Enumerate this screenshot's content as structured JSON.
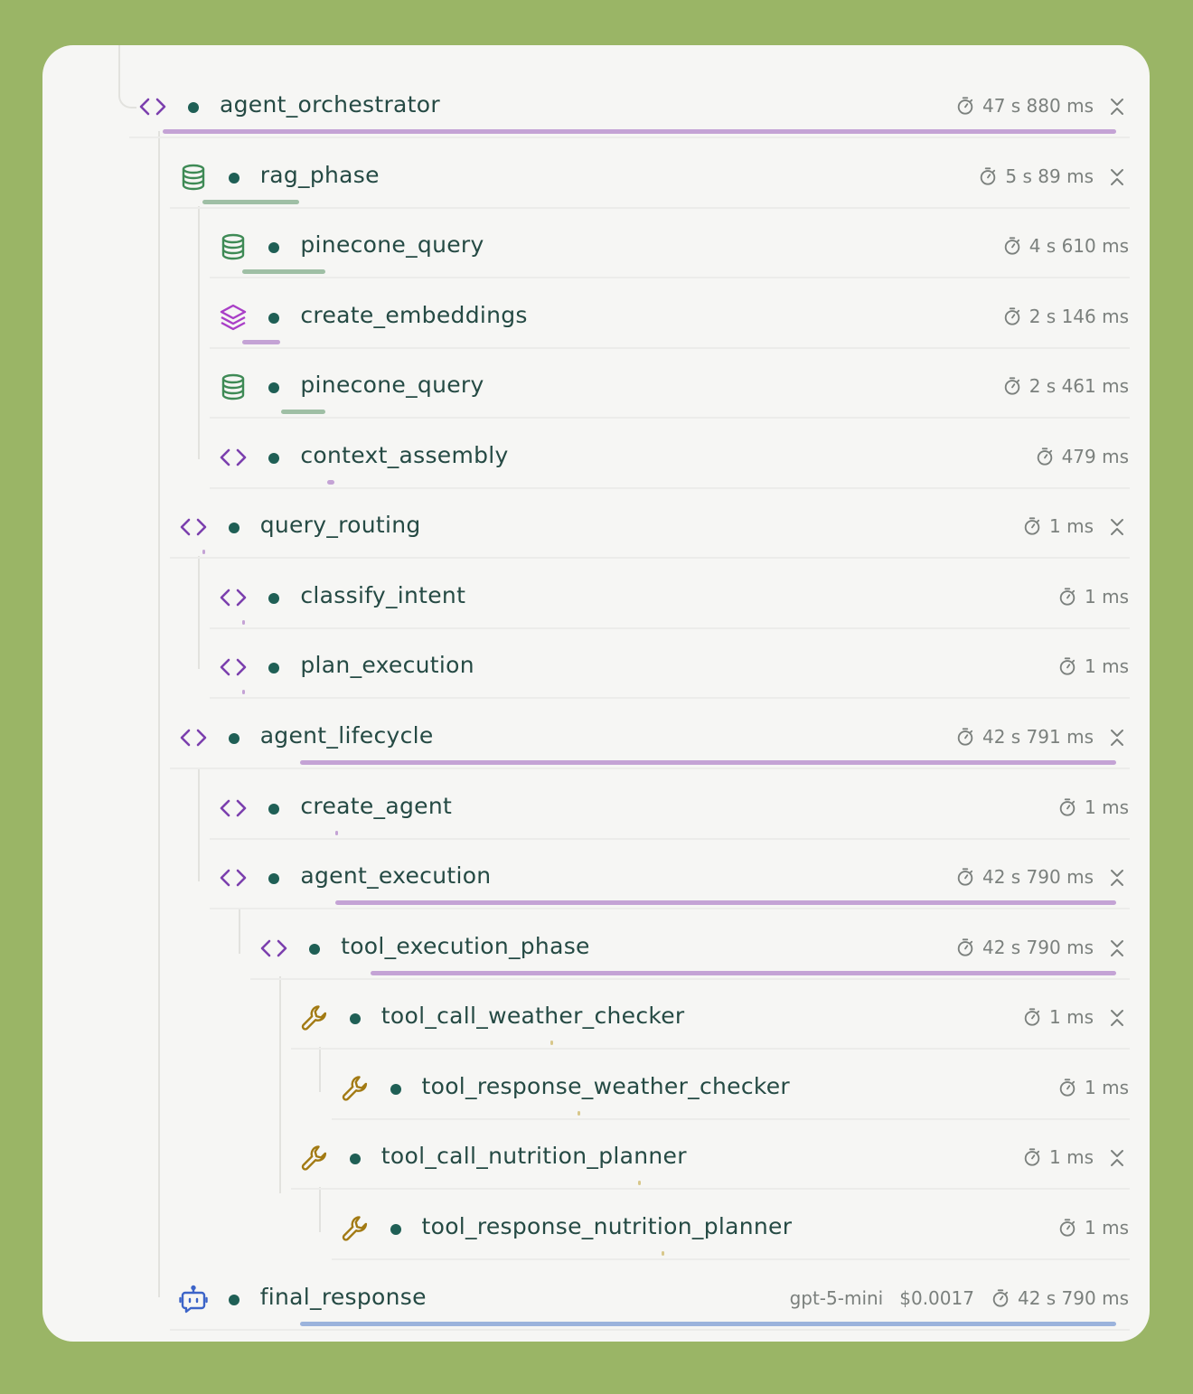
{
  "colors": {
    "code": "#7b3fae",
    "db": "#3e8a55",
    "embed": "#a93fc7",
    "tool": "#a27a13",
    "bot": "#3c64c8",
    "bar_code": "#c4a3d5",
    "bar_db": "#9fbfa5",
    "bar_tool": "#d8c78b",
    "bar_bot": "#9bb3dc"
  },
  "rows": [
    {
      "name": "agent_orchestrator",
      "icon": "code-icon",
      "duration": "47 s 880 ms",
      "collapsible": true
    },
    {
      "name": "rag_phase",
      "icon": "database-icon",
      "duration": "5 s 89 ms",
      "collapsible": true
    },
    {
      "name": "pinecone_query",
      "icon": "database-icon",
      "duration": "4 s 610 ms",
      "collapsible": false
    },
    {
      "name": "create_embeddings",
      "icon": "layers-icon",
      "duration": "2 s 146 ms",
      "collapsible": false
    },
    {
      "name": "pinecone_query",
      "icon": "database-icon",
      "duration": "2 s 461 ms",
      "collapsible": false
    },
    {
      "name": "context_assembly",
      "icon": "code-icon",
      "duration": "479 ms",
      "collapsible": false
    },
    {
      "name": "query_routing",
      "icon": "code-icon",
      "duration": "1 ms",
      "collapsible": true
    },
    {
      "name": "classify_intent",
      "icon": "code-icon",
      "duration": "1 ms",
      "collapsible": false
    },
    {
      "name": "plan_execution",
      "icon": "code-icon",
      "duration": "1 ms",
      "collapsible": false
    },
    {
      "name": "agent_lifecycle",
      "icon": "code-icon",
      "duration": "42 s 791 ms",
      "collapsible": true
    },
    {
      "name": "create_agent",
      "icon": "code-icon",
      "duration": "1 ms",
      "collapsible": false
    },
    {
      "name": "agent_execution",
      "icon": "code-icon",
      "duration": "42 s 790 ms",
      "collapsible": true
    },
    {
      "name": "tool_execution_phase",
      "icon": "code-icon",
      "duration": "42 s 790 ms",
      "collapsible": true
    },
    {
      "name": "tool_call_weather_checker",
      "icon": "wrench-icon",
      "duration": "1 ms",
      "collapsible": true
    },
    {
      "name": "tool_response_weather_checker",
      "icon": "wrench-icon",
      "duration": "1 ms",
      "collapsible": false
    },
    {
      "name": "tool_call_nutrition_planner",
      "icon": "wrench-icon",
      "duration": "1 ms",
      "collapsible": true
    },
    {
      "name": "tool_response_nutrition_planner",
      "icon": "wrench-icon",
      "duration": "1 ms",
      "collapsible": false
    },
    {
      "name": "final_response",
      "icon": "bot-icon",
      "model": "gpt-5-mini",
      "cost": "$0.0017",
      "duration": "42 s 790 ms",
      "collapsible": false
    }
  ]
}
